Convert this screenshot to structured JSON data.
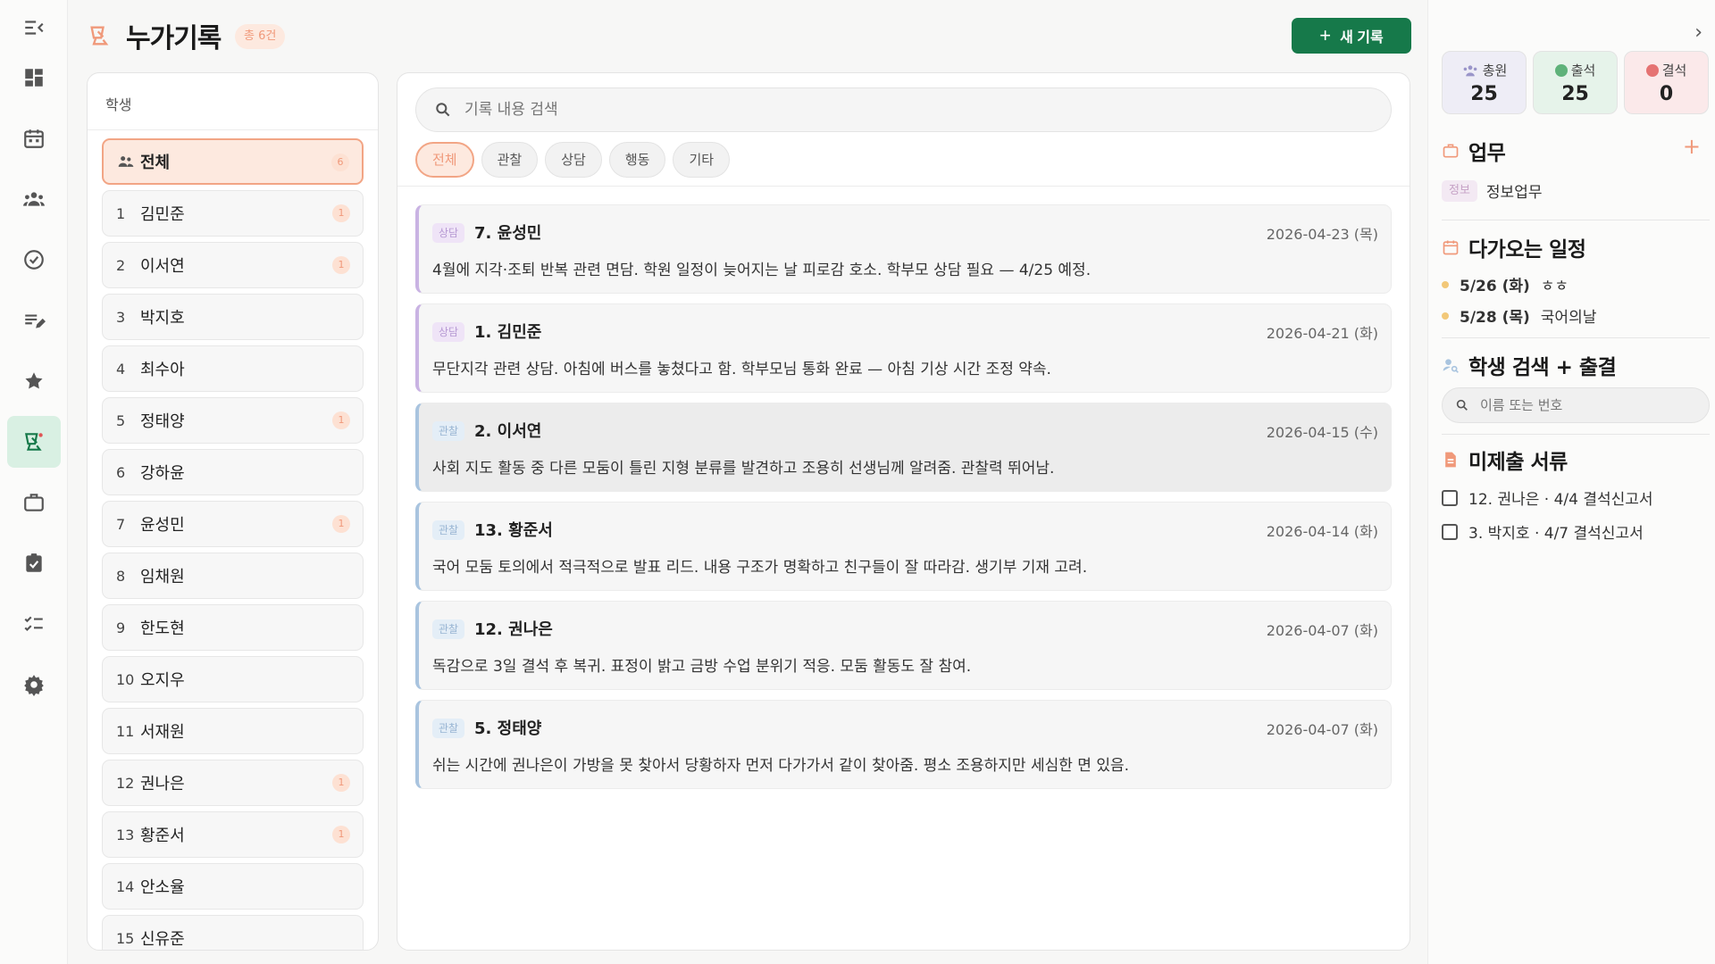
{
  "header": {
    "title": "누가기록",
    "count_badge": "총 6건",
    "new_button_label": "새 기록",
    "new_button_plus": "+"
  },
  "students_panel": {
    "heading": "학생",
    "all_item": {
      "label": "전체",
      "count": "6"
    },
    "students": [
      {
        "num": "1",
        "name": "김민준",
        "count": "1"
      },
      {
        "num": "2",
        "name": "이서연",
        "count": "1"
      },
      {
        "num": "3",
        "name": "박지호",
        "count": ""
      },
      {
        "num": "4",
        "name": "최수아",
        "count": ""
      },
      {
        "num": "5",
        "name": "정태양",
        "count": "1"
      },
      {
        "num": "6",
        "name": "강하윤",
        "count": ""
      },
      {
        "num": "7",
        "name": "윤성민",
        "count": "1"
      },
      {
        "num": "8",
        "name": "임채원",
        "count": ""
      },
      {
        "num": "9",
        "name": "한도현",
        "count": ""
      },
      {
        "num": "10",
        "name": "오지우",
        "count": ""
      },
      {
        "num": "11",
        "name": "서재원",
        "count": ""
      },
      {
        "num": "12",
        "name": "권나은",
        "count": "1"
      },
      {
        "num": "13",
        "name": "황준서",
        "count": "1"
      },
      {
        "num": "14",
        "name": "안소율",
        "count": ""
      },
      {
        "num": "15",
        "name": "신유준",
        "count": ""
      }
    ]
  },
  "records_panel": {
    "search_placeholder": "기록 내용 검색",
    "filters": [
      "전체",
      "관찰",
      "상담",
      "행동",
      "기타"
    ],
    "active_filter": "전체",
    "records": [
      {
        "type": "consult",
        "tag": "상담",
        "student": "7. 윤성민",
        "date": "2026-04-23 (목)",
        "text": "4월에 지각·조퇴 반복 관련 면담. 학원 일정이 늦어지는 날 피로감 호소. 학부모 상담 필요 — 4/25 예정."
      },
      {
        "type": "consult",
        "tag": "상담",
        "student": "1. 김민준",
        "date": "2026-04-21 (화)",
        "text": "무단지각 관련 상담. 아침에 버스를 놓쳤다고 함. 학부모님 통화 완료 — 아침 기상 시간 조정 약속."
      },
      {
        "type": "obs",
        "tag": "관찰",
        "student": "2. 이서연",
        "date": "2026-04-15 (수)",
        "text": "사회 지도 활동 중 다른 모둠이 틀린 지형 분류를 발견하고 조용히 선생님께 알려줌. 관찰력 뛰어남."
      },
      {
        "type": "obs",
        "tag": "관찰",
        "student": "13. 황준서",
        "date": "2026-04-14 (화)",
        "text": "국어 모둠 토의에서 적극적으로 발표 리드. 내용 구조가 명확하고 친구들이 잘 따라감. 생기부 기재 고려."
      },
      {
        "type": "obs",
        "tag": "관찰",
        "student": "12. 권나은",
        "date": "2026-04-07 (화)",
        "text": "독감으로 3일 결석 후 복귀. 표정이 밝고 금방 수업 분위기 적응. 모둠 활동도 잘 참여."
      },
      {
        "type": "obs",
        "tag": "관찰",
        "student": "5. 정태양",
        "date": "2026-04-07 (화)",
        "text": "쉬는 시간에 권나은이 가방을 못 찾아서 당황하자 먼저 다가가서 같이 찾아줌. 평소 조용하지만 세심한 면 있음."
      }
    ]
  },
  "sidebar": {
    "collapse_glyph": "›",
    "stats": [
      {
        "label": "총원",
        "value": "25"
      },
      {
        "label": "출석",
        "value": "25"
      },
      {
        "label": "결석",
        "value": "0"
      }
    ],
    "tasks_title": "업무",
    "add_glyph": "+",
    "tasks": [
      {
        "tag": "정보",
        "label": "정보업무"
      }
    ],
    "schedule_title": "다가오는 일정",
    "events": [
      {
        "date": "5/26 (화)",
        "label": "ㅎㅎ"
      },
      {
        "date": "5/28 (목)",
        "label": "국어의날"
      }
    ],
    "student_search_title": "학생 검색 + 출결",
    "student_search_placeholder": "이름 또는 번호",
    "docs_title": "미제출 서류",
    "docs": [
      {
        "label": "12. 권나은 · 4/4 결석신고서"
      },
      {
        "label": "3. 박지호 · 4/7 결석신고서"
      }
    ]
  },
  "colors": {
    "accent_green": "#16794a",
    "accent_orange": "#f0997a",
    "consult_border": "#c9b3e3",
    "observe_border": "#a9c4df"
  }
}
